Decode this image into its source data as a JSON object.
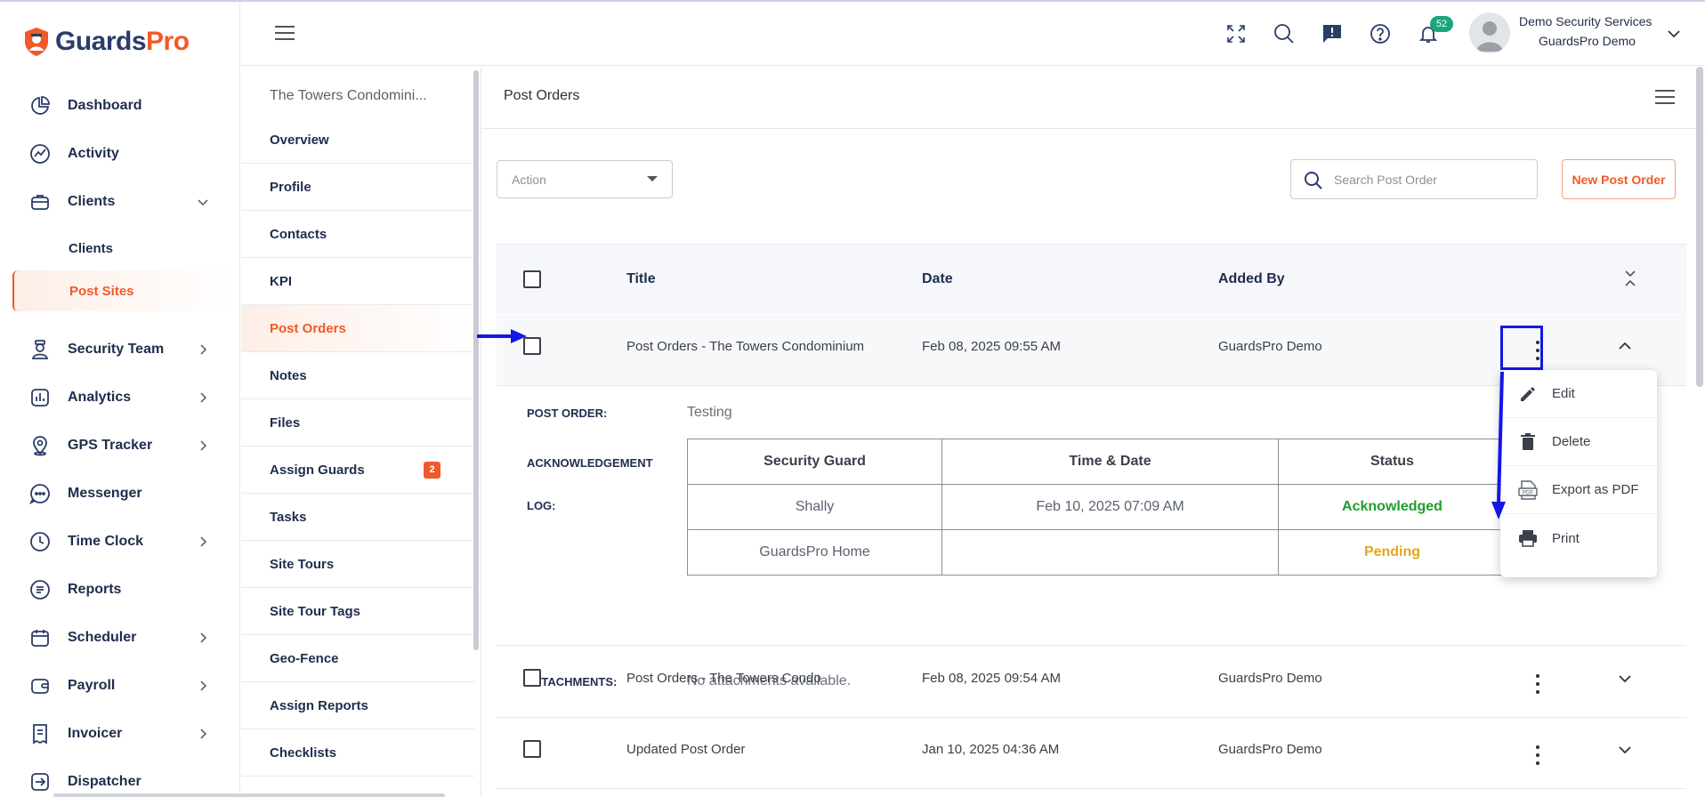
{
  "brand": {
    "name_part1": "Guards",
    "name_part2": "Pro",
    "accent": "#f05a28",
    "navy": "#2a3d69"
  },
  "sidebar": {
    "items": [
      {
        "label": "Dashboard",
        "icon": "dashboard-icon",
        "has_chevron": false
      },
      {
        "label": "Activity",
        "icon": "activity-icon",
        "has_chevron": false
      },
      {
        "label": "Clients",
        "icon": "briefcase-icon",
        "has_chevron": true,
        "expanded": true
      },
      {
        "label": "Security Team",
        "icon": "guard-icon",
        "has_chevron": true
      },
      {
        "label": "Analytics",
        "icon": "analytics-icon",
        "has_chevron": true
      },
      {
        "label": "GPS Tracker",
        "icon": "location-pin-icon",
        "has_chevron": true
      },
      {
        "label": "Messenger",
        "icon": "chat-icon",
        "has_chevron": false
      },
      {
        "label": "Time Clock",
        "icon": "clock-icon",
        "has_chevron": true
      },
      {
        "label": "Reports",
        "icon": "reports-icon",
        "has_chevron": false
      },
      {
        "label": "Scheduler",
        "icon": "calendar-icon",
        "has_chevron": true
      },
      {
        "label": "Payroll",
        "icon": "wallet-icon",
        "has_chevron": true
      },
      {
        "label": "Invoicer",
        "icon": "invoice-icon",
        "has_chevron": true
      },
      {
        "label": "Dispatcher",
        "icon": "dispatch-icon",
        "has_chevron": false
      }
    ],
    "sub_items": [
      {
        "label": "Clients"
      },
      {
        "label": "Post Sites",
        "active": true
      }
    ]
  },
  "header": {
    "notification_count": "52",
    "user_company": "Demo Security Services",
    "user_name": "GuardsPro Demo"
  },
  "site_menu": {
    "site_name": "The Towers Condomini...",
    "items": [
      {
        "label": "Overview"
      },
      {
        "label": "Profile"
      },
      {
        "label": "Contacts"
      },
      {
        "label": "KPI"
      },
      {
        "label": "Post Orders",
        "active": true
      },
      {
        "label": "Notes"
      },
      {
        "label": "Files"
      },
      {
        "label": "Assign Guards",
        "badge": "2"
      },
      {
        "label": "Tasks"
      },
      {
        "label": "Site Tours"
      },
      {
        "label": "Site Tour Tags"
      },
      {
        "label": "Geo-Fence"
      },
      {
        "label": "Assign Reports"
      },
      {
        "label": "Checklists"
      }
    ]
  },
  "main": {
    "title": "Post Orders",
    "action_label": "Action",
    "search_placeholder": "Search Post Order",
    "new_button": "New Post Order",
    "columns": {
      "title": "Title",
      "date": "Date",
      "added_by": "Added By"
    },
    "rows": [
      {
        "title": "Post Orders - The Towers Condominium",
        "date": "Feb 08, 2025 09:55 AM",
        "added_by": "GuardsPro Demo",
        "expanded": true
      },
      {
        "title": "Post Orders - The Towers Condo",
        "date": "Feb 08, 2025 09:54 AM",
        "added_by": "GuardsPro Demo",
        "expanded": false
      },
      {
        "title": "Updated Post Order",
        "date": "Jan 10, 2025 04:36 AM",
        "added_by": "GuardsPro Demo",
        "expanded": false
      }
    ],
    "detail": {
      "post_order_label": "POST ORDER:",
      "post_order_value": "Testing",
      "ack_label_1": "ACKNOWLEDGEMENT",
      "ack_label_2": "LOG:",
      "ack_headers": [
        "Security Guard",
        "Time & Date",
        "Status"
      ],
      "ack_rows": [
        {
          "guard": "Shally",
          "time": "Feb 10, 2025 07:09 AM",
          "status": "Acknowledged"
        },
        {
          "guard": "GuardsPro Home",
          "time": "",
          "status": "Pending"
        }
      ],
      "attachments_label": "ATTACHMENTS:",
      "attachments_value": "No attachments available."
    },
    "row_menu": [
      {
        "label": "Edit",
        "icon": "pencil-icon"
      },
      {
        "label": "Delete",
        "icon": "trash-icon"
      },
      {
        "label": "Export as PDF",
        "icon": "pdf-icon"
      },
      {
        "label": "Print",
        "icon": "printer-icon"
      }
    ]
  },
  "annotation_color": "#1515e8"
}
